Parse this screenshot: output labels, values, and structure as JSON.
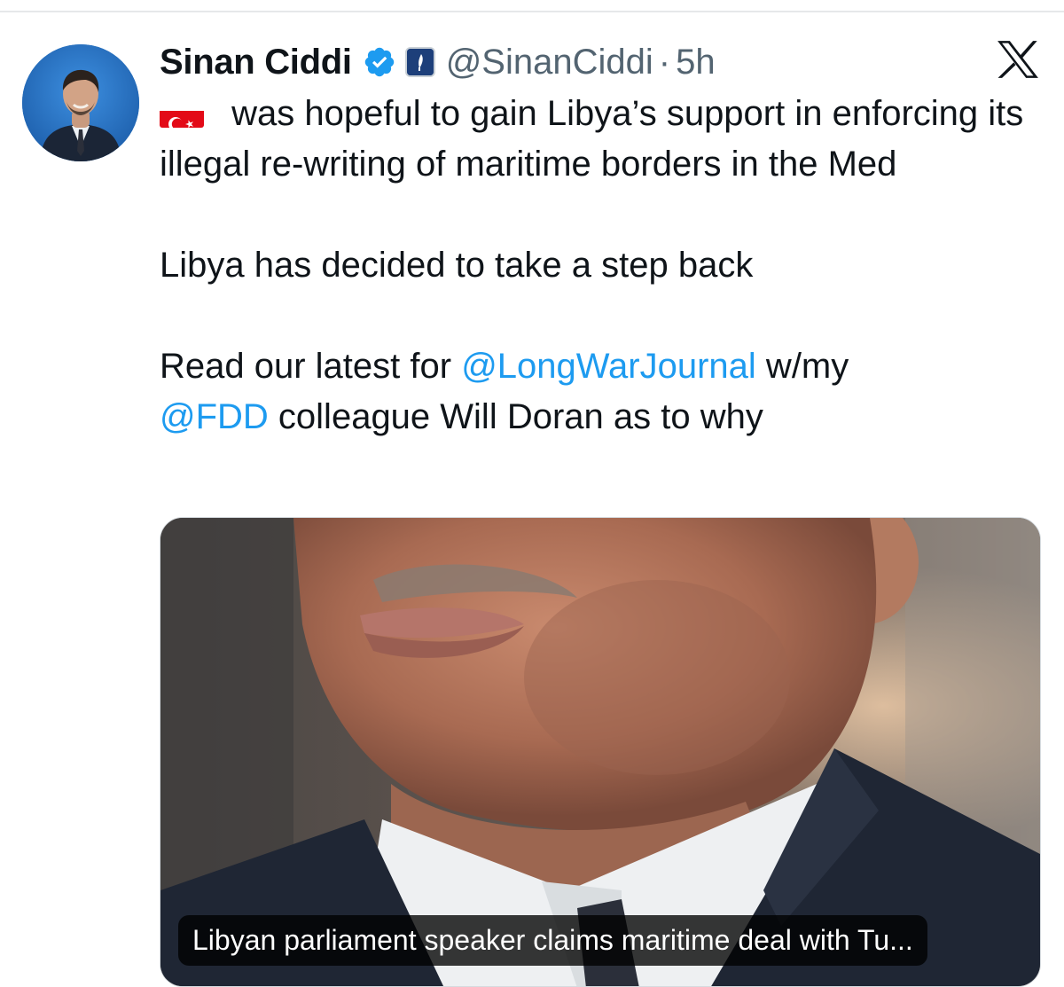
{
  "tweet": {
    "author": {
      "display_name": "Sinan Ciddi",
      "handle": "@SinanCiddi",
      "verified": true,
      "avatar_icon": "avatar"
    },
    "separator": "·",
    "timestamp": "5h",
    "platform_icon": "x-logo-icon",
    "flag_icon": "turkey-flag-icon",
    "text": {
      "line1_after_flag": " was hopeful to gain Libya’s support in enforcing its illegal re-writing of maritime borders in the Med",
      "paragraph2": "Libya has decided to take a step back",
      "paragraph3_before": "Read our latest for ",
      "mention1": "@LongWarJournal",
      "paragraph3_middle": " w/my",
      "mention2": "@FDD",
      "paragraph3_after": " colleague Will Doran as to why"
    },
    "card": {
      "caption": "Libyan parliament speaker claims maritime deal with Tu..."
    }
  },
  "colors": {
    "link": "#1d9bf0",
    "text": "#0f1419",
    "secondary": "#536471",
    "verified": "#1d9bf0"
  }
}
